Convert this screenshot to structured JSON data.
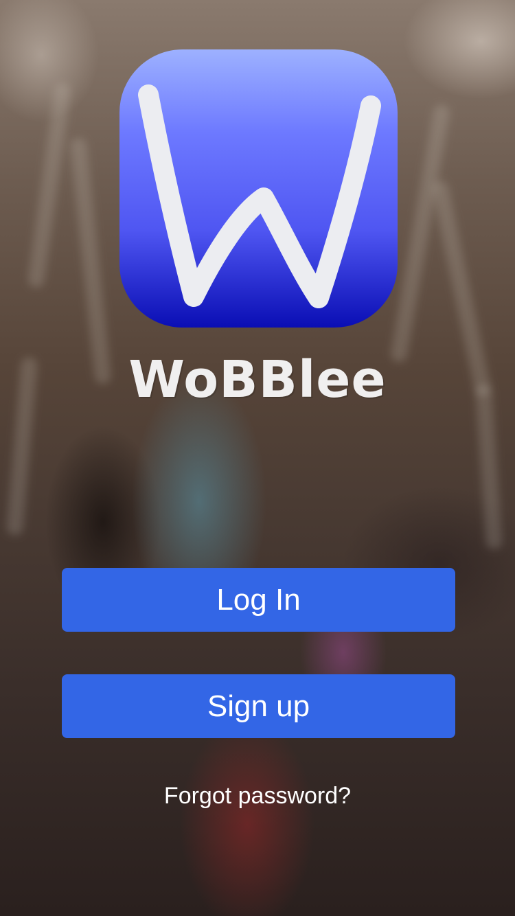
{
  "app": {
    "logo_letter": "W",
    "brand_name": "WoBBlee"
  },
  "actions": {
    "login_label": "Log In",
    "signup_label": "Sign up",
    "forgot_label": "Forgot password?"
  },
  "colors": {
    "button": "#3366e6",
    "logo_top": "#9db1ff",
    "logo_bottom": "#0a0eb4",
    "text": "#ffffff"
  },
  "icons": {
    "logo": "app-logo-icon"
  }
}
